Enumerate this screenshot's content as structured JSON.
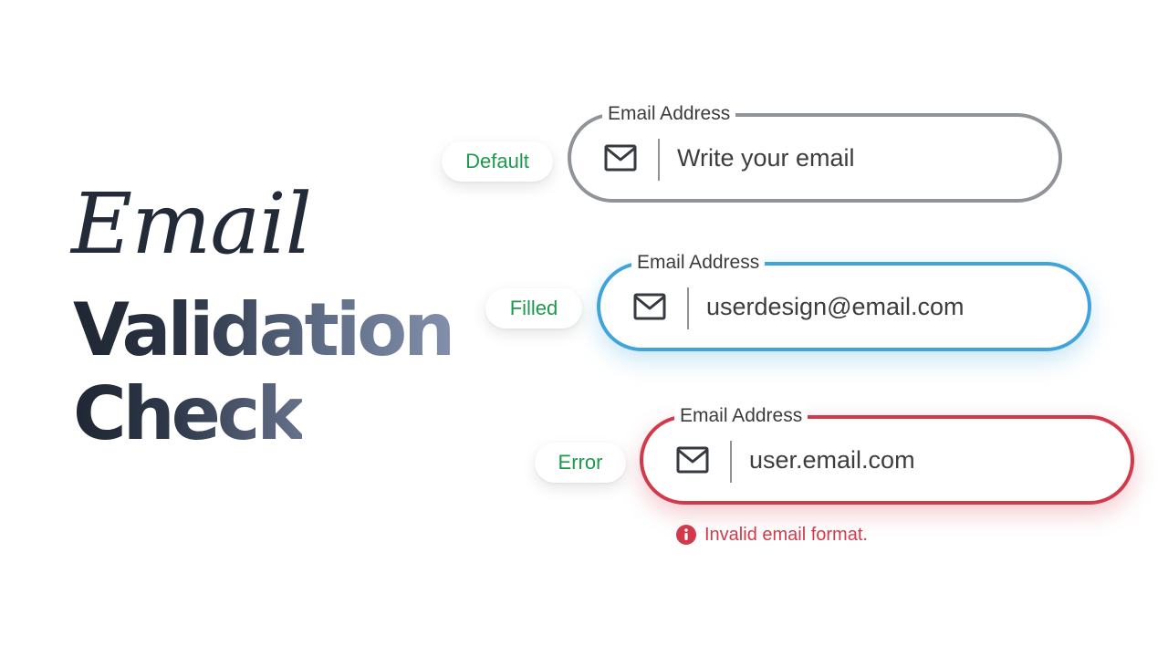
{
  "title": {
    "line1": "Email",
    "line2": "Validation",
    "line3": "Check"
  },
  "colors": {
    "default_border": "#909499",
    "filled_border": "#3fa4db",
    "error_border": "#d23a4b",
    "tag_text": "#1c9a4b",
    "error_text": "#d23a4b"
  },
  "icons": {
    "field": "mail-icon",
    "error": "info-circle-icon"
  },
  "states": {
    "default": {
      "tag": "Default",
      "label": "Email Address",
      "placeholder": "Write your email",
      "value": ""
    },
    "filled": {
      "tag": "Filled",
      "label": "Email Address",
      "value": "userdesign@email.com"
    },
    "error": {
      "tag": "Error",
      "label": "Email Address",
      "value": "user.email.com",
      "message": "Invalid email format."
    }
  }
}
